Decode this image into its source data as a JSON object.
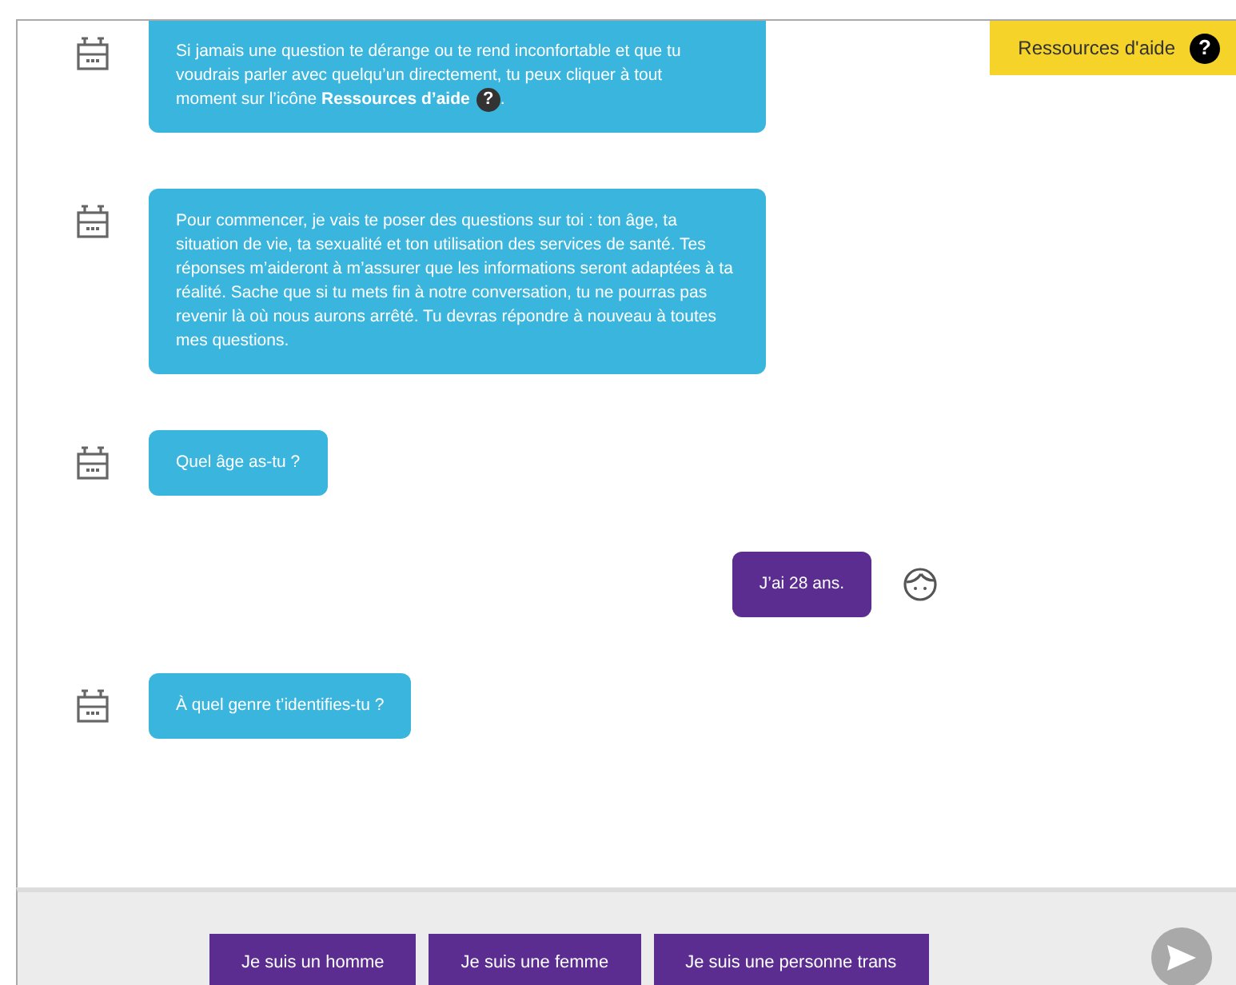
{
  "help_button": {
    "label": "Ressources d'aide",
    "glyph": "?"
  },
  "messages": [
    {
      "kind": "bot",
      "text": "Si jamais une question te dérange ou te rend inconfortable et que tu voudrais parler avec quelqu’un directement, tu peux cliquer à tout",
      "text_end": "moment sur l’icône **Ressources d’aide**",
      "glyph": "?",
      "text_after": "."
    },
    {
      "kind": "bot",
      "text": "Pour commencer, je vais te poser des questions sur toi : ton âge, ta situation de vie, ta sexualité et ton utilisation des services de santé. Tes réponses m’aideront à m’assurer que les informations seront adaptées à ta réalité. Sache que si tu mets fin à notre conversation, tu ne pourras pas revenir là où nous aurons arrêté. Tu devras répondre à nouveau à toutes mes questions."
    },
    {
      "kind": "bot",
      "text": "Quel âge as-tu ?"
    },
    {
      "kind": "user",
      "text": "J’ai 28 ans."
    },
    {
      "kind": "bot",
      "text": "À quel genre t’identifies-tu ?"
    }
  ],
  "answer_options": [
    "Je suis un homme",
    "Je suis une femme",
    "Je suis une personne trans"
  ]
}
